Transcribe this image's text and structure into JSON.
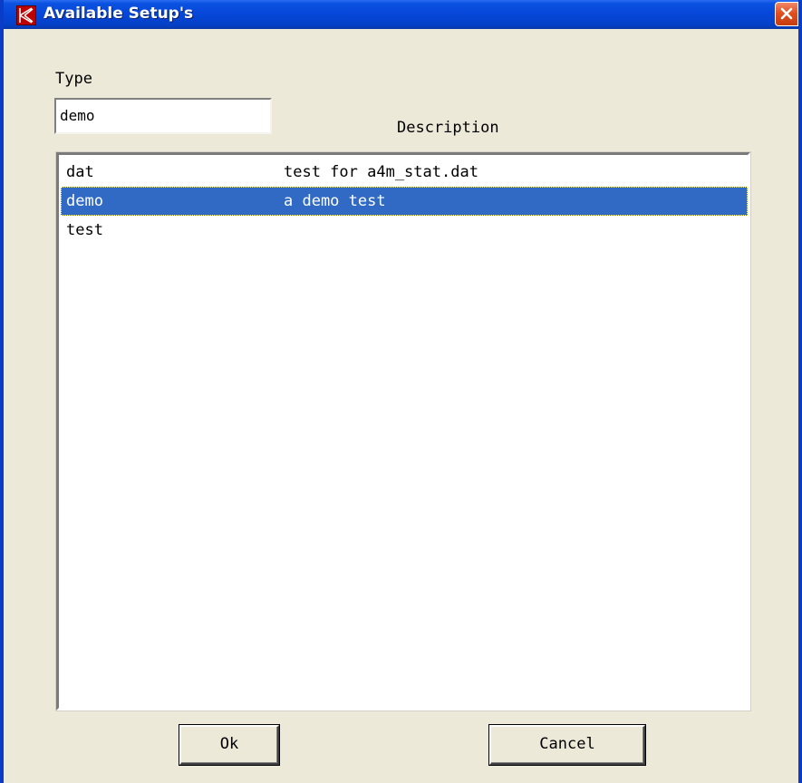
{
  "window": {
    "title": "Available Setup's",
    "icon": "app-k-logo-icon",
    "close_icon": "close-icon"
  },
  "type_label": "Type",
  "type_input": {
    "value": "demo"
  },
  "description_label": "Description",
  "setups": [
    {
      "type": "dat",
      "description": "test for a4m_stat.dat",
      "selected": false
    },
    {
      "type": "demo",
      "description": "a demo test",
      "selected": true
    },
    {
      "type": "test",
      "description": "",
      "selected": false
    }
  ],
  "buttons": {
    "ok_label": "Ok",
    "cancel_label": "Cancel"
  },
  "colors": {
    "titlebar": "#0646d8",
    "selection": "#316ac5",
    "dialog_bg": "#ece9d8"
  }
}
